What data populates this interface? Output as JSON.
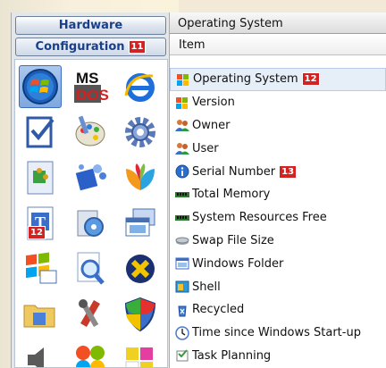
{
  "sidebar": {
    "hardware_label": "Hardware",
    "configuration_label": "Configuration",
    "configuration_badge": "11",
    "grid_badge": "12",
    "icons": [
      "windows-logo-icon",
      "msdos-icon",
      "internet-explorer-icon",
      "checklist-icon",
      "paint-palette-icon",
      "gear-icon",
      "puzzle-document-icon",
      "network-puzzle-icon",
      "msn-butterfly-icon",
      "font-document-icon",
      "drive-tools-icon",
      "computer-window-icon",
      "windows-flag-icon",
      "search-magnifier-icon",
      "remove-x-icon",
      "folder-tools-icon",
      "tools-icon",
      "shield-icon",
      "speaker-icon",
      "windows-flag-round-icon",
      "taskbar-color-icon"
    ]
  },
  "pane": {
    "title": "Operating System",
    "column_header": "Item"
  },
  "items": [
    {
      "label": "Operating System",
      "icon": "windows-flag-icon",
      "badge": "12",
      "selected": true
    },
    {
      "label": "Version",
      "icon": "windows-flag-icon"
    },
    {
      "label": "Owner",
      "icon": "users-icon"
    },
    {
      "label": "User",
      "icon": "users-icon"
    },
    {
      "label": "Serial Number",
      "icon": "info-icon",
      "badge": "13"
    },
    {
      "label": "Total Memory",
      "icon": "memory-chip-icon"
    },
    {
      "label": "System Resources Free",
      "icon": "memory-chip-icon"
    },
    {
      "label": "Swap File Size",
      "icon": "disk-icon"
    },
    {
      "label": "Windows Folder",
      "icon": "window-icon"
    },
    {
      "label": "Shell",
      "icon": "shell-window-icon"
    },
    {
      "label": "Recycled",
      "icon": "recycle-bin-icon"
    },
    {
      "label": "Time since Windows Start-up",
      "icon": "clock-icon"
    },
    {
      "label": "Task Planning",
      "icon": "task-planner-icon"
    }
  ]
}
